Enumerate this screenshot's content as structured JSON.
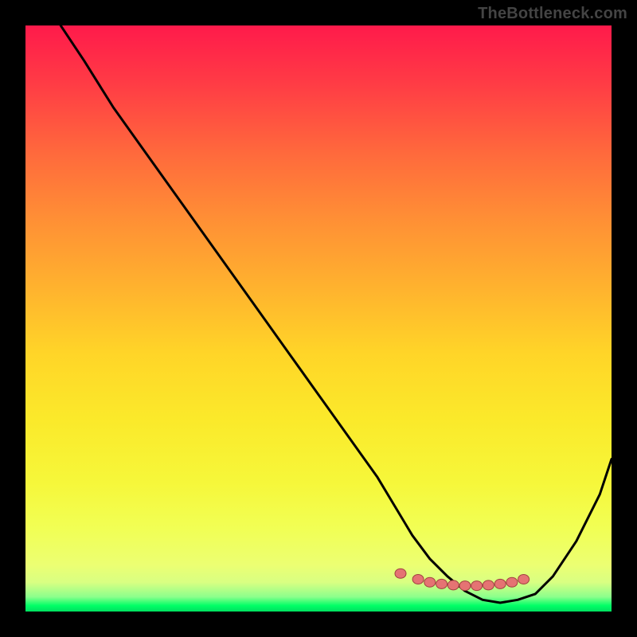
{
  "watermark": "TheBottleneck.com",
  "colors": {
    "background": "#000000",
    "gradient_top": "#ff1a4b",
    "gradient_bottom": "#00e060",
    "curve": "#000000",
    "marker_fill": "#e57373",
    "marker_stroke": "#a04040",
    "watermark": "#444444"
  },
  "chart_data": {
    "type": "line",
    "title": "",
    "xlabel": "",
    "ylabel": "",
    "xlim": [
      0,
      100
    ],
    "ylim": [
      0,
      100
    ],
    "description": "Bottleneck curve: y is bottleneck percentage (0 at bottom = balanced/green, 100 at top = severe/red). x is relative component performance. Curve descends steeply from upper-left, reaches a flat minimum near x≈70–80, then rises toward the right edge.",
    "series": [
      {
        "name": "bottleneck-curve",
        "x": [
          6,
          10,
          15,
          20,
          25,
          30,
          35,
          40,
          45,
          50,
          55,
          60,
          63,
          66,
          69,
          72,
          75,
          78,
          81,
          84,
          87,
          90,
          94,
          98,
          100
        ],
        "y": [
          100,
          94,
          86,
          79,
          72,
          65,
          58,
          51,
          44,
          37,
          30,
          23,
          18,
          13,
          9,
          6,
          3.5,
          2,
          1.5,
          2,
          3,
          6,
          12,
          20,
          26
        ]
      }
    ],
    "markers": {
      "name": "optimal-range",
      "x": [
        64,
        67,
        69,
        71,
        73,
        75,
        77,
        79,
        81,
        83,
        85
      ],
      "y": [
        6.5,
        5.5,
        5,
        4.7,
        4.5,
        4.4,
        4.4,
        4.5,
        4.7,
        5,
        5.5
      ]
    }
  }
}
